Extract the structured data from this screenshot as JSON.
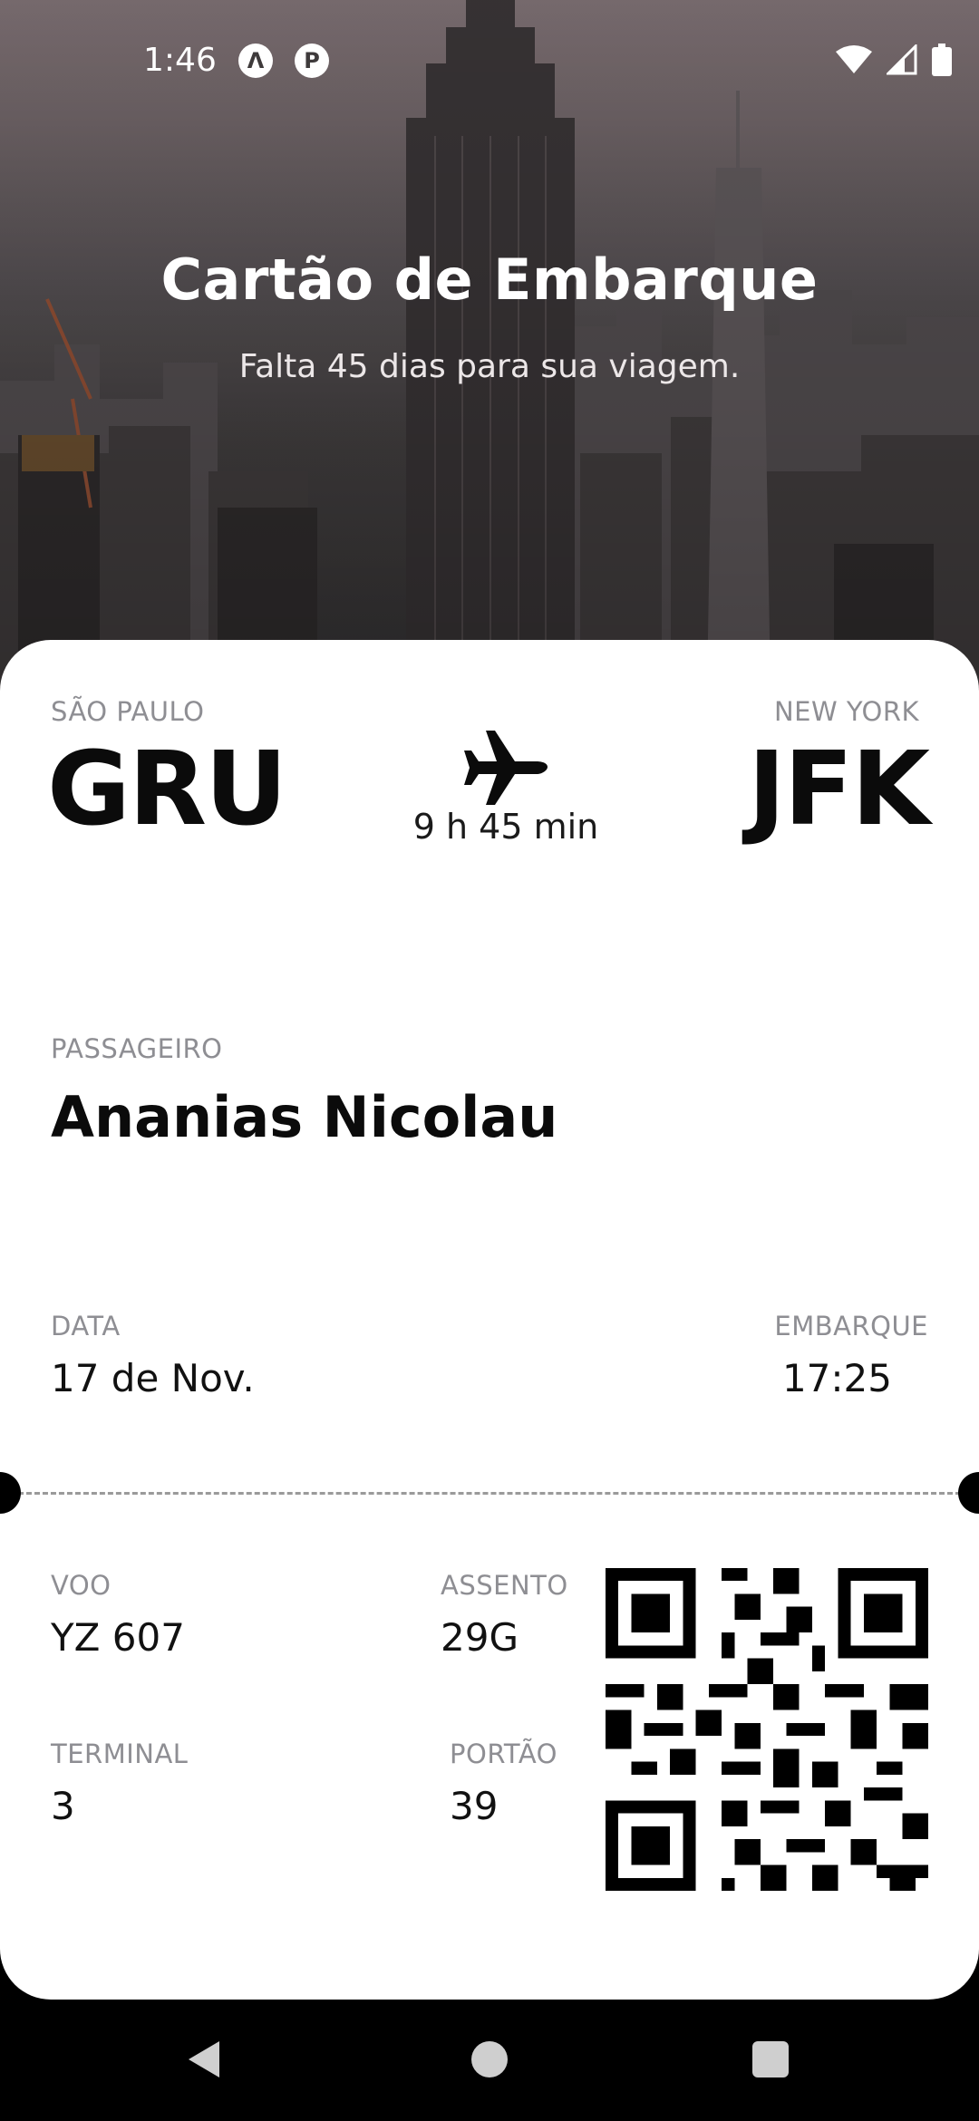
{
  "status_bar": {
    "time": "1:46",
    "app_icons": [
      "Λ",
      "P"
    ]
  },
  "hero": {
    "title": "Cartão de Embarque",
    "subtitle": "Falta 45 dias para sua viagem."
  },
  "ticket": {
    "origin": {
      "city": "SÃO PAULO",
      "code": "GRU"
    },
    "destination": {
      "city": "NEW YORK",
      "code": "JFK"
    },
    "duration": "9 h 45 min",
    "passenger": {
      "label": "PASSAGEIRO",
      "name": "Ananias Nicolau"
    },
    "date": {
      "label": "DATA",
      "value": "17 de Nov."
    },
    "boarding": {
      "label": "EMBARQUE",
      "value": "17:25"
    },
    "flight": {
      "label": "VOO",
      "value": "YZ 607"
    },
    "seat": {
      "label": "ASSENTO",
      "value": "29G"
    },
    "terminal": {
      "label": "TERMINAL",
      "value": "3"
    },
    "gate": {
      "label": "PORTÃO",
      "value": "39"
    }
  },
  "icons": {
    "plane": "airplane-icon",
    "qr": "qr-code",
    "nav": [
      "back-icon",
      "home-icon",
      "recents-icon"
    ],
    "status": [
      "wifi-icon",
      "cell-signal-icon",
      "battery-icon"
    ]
  },
  "colors": {
    "card_bg": "#ffffff",
    "label": "#8e8e93",
    "text": "#0b0b0b",
    "nav_bg": "#000000"
  }
}
